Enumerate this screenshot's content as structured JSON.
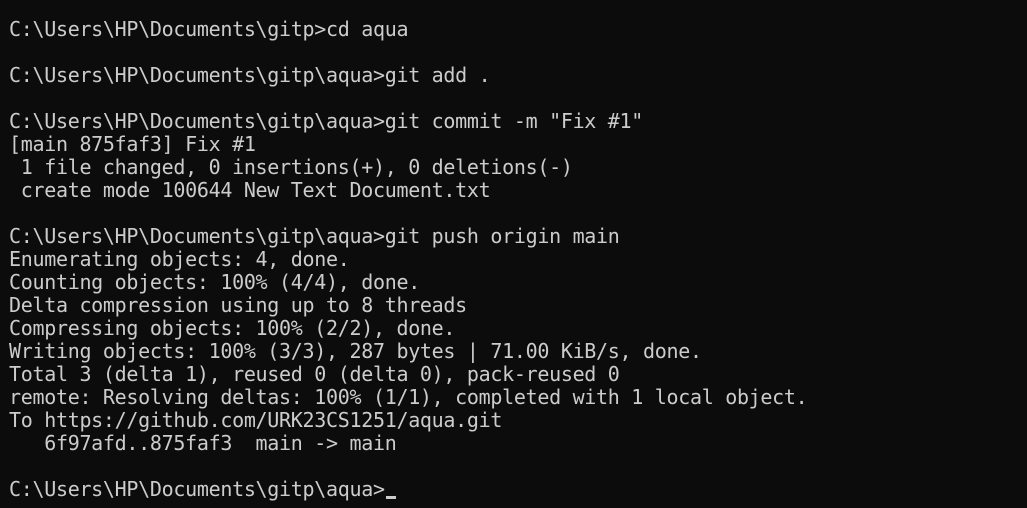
{
  "terminal": {
    "background": "#0c0c0c",
    "foreground": "#cccccc",
    "lines": [
      "C:\\Users\\HP\\Documents\\gitp>cd aqua",
      "",
      "C:\\Users\\HP\\Documents\\gitp\\aqua>git add .",
      "",
      "C:\\Users\\HP\\Documents\\gitp\\aqua>git commit -m \"Fix #1\"",
      "[main 875faf3] Fix #1",
      " 1 file changed, 0 insertions(+), 0 deletions(-)",
      " create mode 100644 New Text Document.txt",
      "",
      "C:\\Users\\HP\\Documents\\gitp\\aqua>git push origin main",
      "Enumerating objects: 4, done.",
      "Counting objects: 100% (4/4), done.",
      "Delta compression using up to 8 threads",
      "Compressing objects: 100% (2/2), done.",
      "Writing objects: 100% (3/3), 287 bytes | 71.00 KiB/s, done.",
      "Total 3 (delta 1), reused 0 (delta 0), pack-reused 0",
      "remote: Resolving deltas: 100% (1/1), completed with 1 local object.",
      "To https://github.com/URK23CS1251/aqua.git",
      "   6f97afd..875faf3  main -> main",
      "",
      "C:\\Users\\HP\\Documents\\gitp\\aqua>"
    ]
  }
}
